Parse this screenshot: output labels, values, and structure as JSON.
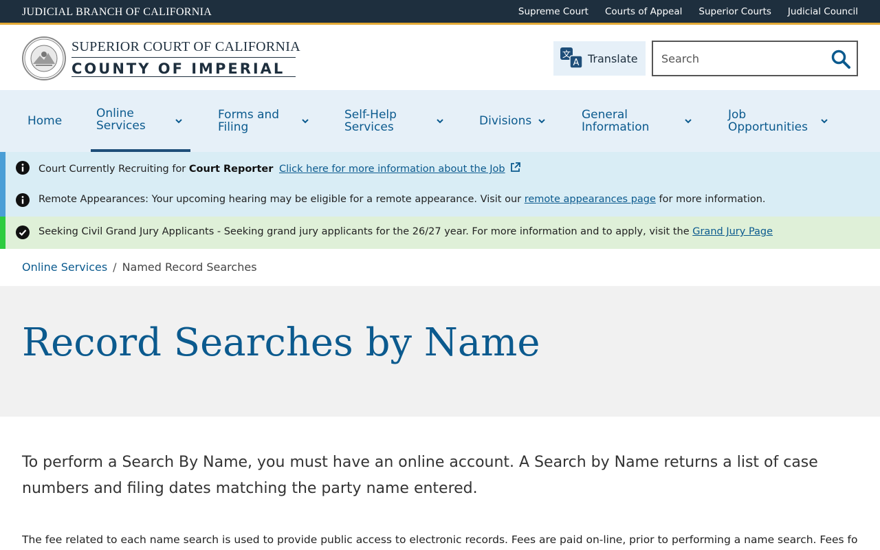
{
  "topbar": {
    "branch": "JUDICIAL BRANCH OF CALIFORNIA",
    "links": [
      "Supreme Court",
      "Courts of Appeal",
      "Superior Courts",
      "Judicial Council"
    ]
  },
  "header": {
    "court_line1": "SUPERIOR COURT OF CALIFORNIA",
    "court_line2": "COUNTY OF IMPERIAL",
    "translate_label": "Translate",
    "search_placeholder": "Search"
  },
  "nav": {
    "items": [
      {
        "label": "Home"
      },
      {
        "label": "Online Services"
      },
      {
        "label": "Forms and Filing"
      },
      {
        "label": "Self-Help Services"
      },
      {
        "label": "Divisions"
      },
      {
        "label": "General Information"
      },
      {
        "label": "Job Opportunities"
      }
    ]
  },
  "alerts": {
    "a1": {
      "prefix": "Court Currently Recruiting for ",
      "bold": "Court Reporter",
      "link": "Click here for more information about the Job"
    },
    "a2": {
      "prefix": "Remote Appearances: Your upcoming hearing may be eligible for a remote appearance. Visit our ",
      "link": "remote appearances page",
      "suffix": " for more information."
    },
    "a3": {
      "prefix": "Seeking Civil Grand Jury Applicants - Seeking grand jury applicants for the 26/27 year. For more information and to apply, visit the ",
      "link": "Grand Jury Page"
    }
  },
  "breadcrumb": {
    "parent": "Online Services",
    "separator": "/",
    "current": "Named Record Searches"
  },
  "page": {
    "title": "Record Searches by Name",
    "lead": "To perform a Search By Name, you must have an online account. A Search by Name returns a list of case numbers and filing dates matching the party name entered.",
    "para": "The fee related to each name search is used to provide public access to electronic records. Fees are paid on-line, prior to performing a name search. Fees for multiple"
  },
  "colors": {
    "navy": "#1e2f3e",
    "gold": "#e3a934",
    "link_blue": "#0b5a8e",
    "nav_bg": "#e6f0f8",
    "info_bg": "#d9edf5",
    "success_bg": "#dff0d8"
  }
}
